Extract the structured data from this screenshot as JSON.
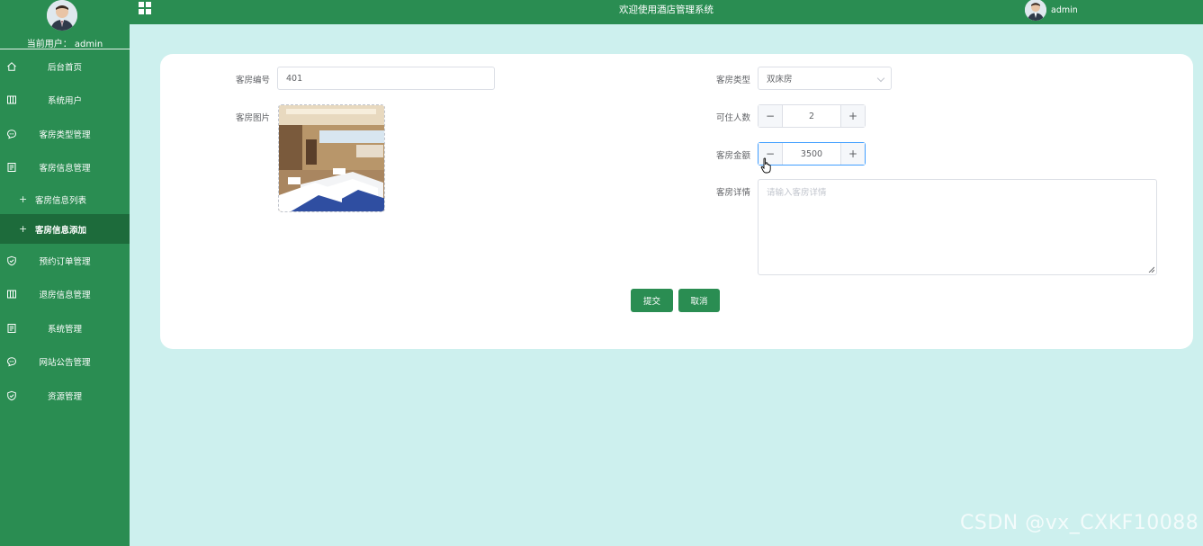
{
  "header": {
    "title": "欢迎使用酒店管理系统",
    "username": "admin"
  },
  "sidebar": {
    "current_user_label": "当前用户：",
    "current_user": "admin",
    "items": [
      {
        "label": "后台首页",
        "icon": "home-icon"
      },
      {
        "label": "系统用户",
        "icon": "columns-icon"
      },
      {
        "label": "客房类型管理",
        "icon": "chat-icon"
      },
      {
        "label": "客房信息管理",
        "icon": "document-icon"
      }
    ],
    "sub_items": [
      {
        "label": "客房信息列表",
        "active": false
      },
      {
        "label": "客房信息添加",
        "active": true
      }
    ],
    "items_after": [
      {
        "label": "预约订单管理",
        "icon": "shield-icon"
      },
      {
        "label": "退房信息管理",
        "icon": "columns-icon"
      },
      {
        "label": "系统管理",
        "icon": "document-icon"
      },
      {
        "label": "网站公告管理",
        "icon": "chat-icon"
      },
      {
        "label": "资源管理",
        "icon": "shield-icon"
      }
    ]
  },
  "form": {
    "room_number": {
      "label": "客房编号",
      "value": "401"
    },
    "room_image": {
      "label": "客房图片"
    },
    "room_type": {
      "label": "客房类型",
      "value": "双床房"
    },
    "capacity": {
      "label": "可住人数",
      "value": "2"
    },
    "price": {
      "label": "客房金额",
      "value": "3500"
    },
    "details": {
      "label": "客房详情",
      "placeholder": "请输入客房详情"
    },
    "submit_label": "提交",
    "cancel_label": "取消"
  },
  "watermark": "CSDN @vx_CXKF10088",
  "colors": {
    "primary": "#2a8d52",
    "active_bg": "#1d6b3b",
    "page_bg": "#cdf0ee"
  }
}
